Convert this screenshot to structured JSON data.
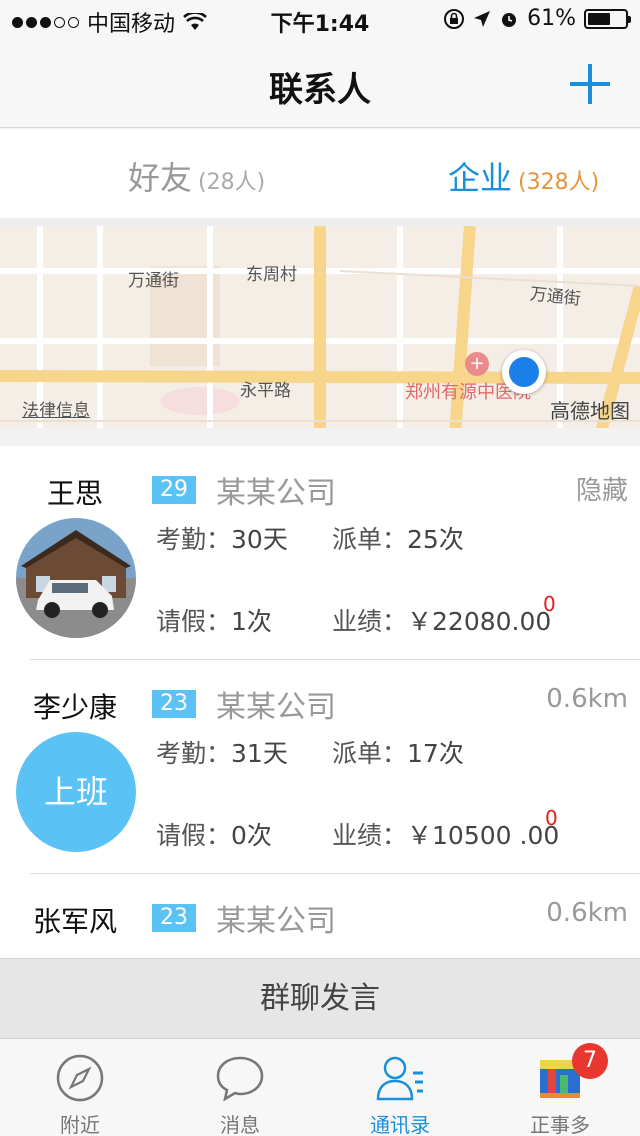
{
  "status_bar": {
    "carrier": "中国移动",
    "time": "下午1:44",
    "battery": "61%",
    "battery_level": 0.61
  },
  "nav": {
    "title": "联系人"
  },
  "tabs": [
    {
      "label": "好友",
      "count": "(28人)"
    },
    {
      "label": "企业",
      "count": "(328人)"
    }
  ],
  "map": {
    "labels": [
      "万通街",
      "东周村",
      "万通街",
      "永平路",
      "法律信息",
      "郑州有源中医院"
    ],
    "brand": "高德地图"
  },
  "contacts": [
    {
      "name": "王思",
      "age": "29",
      "company": "某某公司",
      "right": "隐藏",
      "attendance_label": "考勤：",
      "attendance": "30天",
      "dispatch_label": "派单：",
      "dispatch": "25次",
      "leave_label": "请假：",
      "leave": "1次",
      "performance_label": "业绩：",
      "performance": "￥22080.00",
      "sup": "0",
      "avatar_text": ""
    },
    {
      "name": "李少康",
      "age": "23",
      "company": "某某公司",
      "right": "0.6km",
      "attendance_label": "考勤：",
      "attendance": "31天",
      "dispatch_label": "派单：",
      "dispatch": "17次",
      "leave_label": "请假：",
      "leave": "0次",
      "performance_label": "业绩：",
      "performance": "￥10500 .00",
      "sup": "0",
      "avatar_text": "上班"
    },
    {
      "name": "张军风",
      "age": "23",
      "company": "某某公司",
      "right": "0.6km"
    }
  ],
  "group_chat": "群聊发言",
  "tab_bar": [
    {
      "label": "附近",
      "icon": "compass-icon"
    },
    {
      "label": "消息",
      "icon": "chat-bubble-icon"
    },
    {
      "label": "通讯录",
      "icon": "contacts-icon"
    },
    {
      "label": "正事多",
      "icon": "app-logo-icon",
      "badge": "7"
    }
  ],
  "colors": {
    "accent": "#1a8fdc",
    "badge_blue": "#5bc2f5",
    "orange": "#e8923a",
    "red": "#e02020"
  }
}
